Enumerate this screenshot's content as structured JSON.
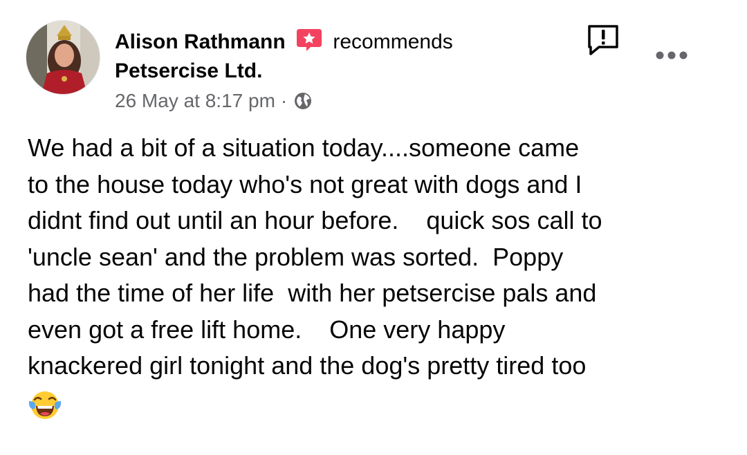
{
  "post": {
    "author": "Alison Rathmann",
    "action": "recommends",
    "page": "Petsercise Ltd.",
    "timestamp": "26 May at 8:17 pm",
    "separator": "·",
    "privacy_icon": "globe-icon",
    "body_lines": [
      "We had a bit of a situation today....someone came",
      "to the house today who's not great with dogs and I",
      "didnt find out until an hour before.    quick sos call to",
      "'uncle sean' and the problem was sorted.  Poppy",
      "had the time of her life  with her petsercise pals and",
      "even got a free lift home.    One very happy",
      "knackered girl tonight and the dog's pretty tired too"
    ],
    "emoji": "face-with-tears-of-joy"
  },
  "icons": {
    "recommend_badge": "recommend-star-badge-icon",
    "report": "report-exclamation-icon",
    "more": "more-options-icon"
  },
  "colors": {
    "text": "#050505",
    "secondary_text": "#65676b",
    "recommend_badge": "#f3425f"
  }
}
